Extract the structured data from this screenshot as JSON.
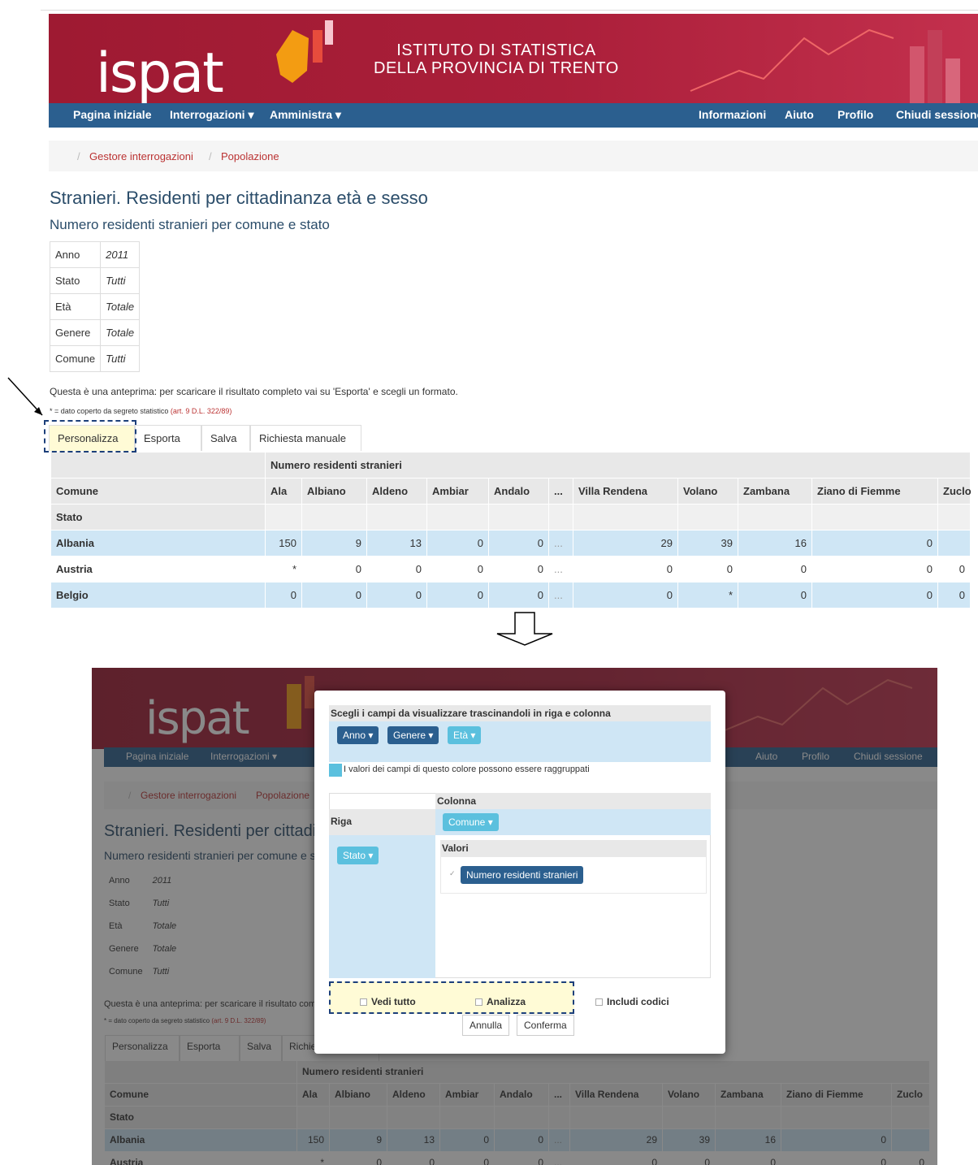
{
  "header": {
    "logo": "ispat",
    "institute_line1": "ISTITUTO DI STATISTICA",
    "institute_line2": "DELLA PROVINCIA DI TRENTO"
  },
  "nav": {
    "home": "Pagina iniziale",
    "queries": "Interrogazioni ▾",
    "admin": "Amministra ▾",
    "info": "Informazioni",
    "help": "Aiuto",
    "profile": "Profilo",
    "logout": "Chiudi sessione"
  },
  "breadcrumb": {
    "sep": "/",
    "item1": "Gestore interrogazioni",
    "item2": "Popolazione"
  },
  "page": {
    "title": "Stranieri. Residenti per cittadinanza età e sesso",
    "subtitle": "Numero residenti stranieri per comune e stato",
    "meta": [
      {
        "label": "Anno",
        "value": "2011"
      },
      {
        "label": "Stato",
        "value": "Tutti"
      },
      {
        "label": "Età",
        "value": "Totale"
      },
      {
        "label": "Genere",
        "value": "Totale"
      },
      {
        "label": "Comune",
        "value": "Tutti"
      }
    ],
    "preview_note": "Questa è una anteprima: per scaricare il risultato completo vai su 'Esporta' e scegli un formato.",
    "secret_note": "* = dato coperto da segreto statistico",
    "secret_ref": "(art. 9 D.L. 322/89)",
    "tabs": {
      "customize": "Personalizza",
      "export": "Esporta",
      "save": "Salva",
      "manual": "Richiesta manuale"
    }
  },
  "table": {
    "measure": "Numero residenti stranieri",
    "row_dim1": "Comune",
    "row_dim2": "Stato",
    "columns": [
      "Ala",
      "Albiano",
      "Aldeno",
      "Ambiar",
      "Andalo",
      "...",
      "Villa Rendena",
      "Volano",
      "Zambana",
      "Ziano di Fiemme",
      "Zuclo"
    ],
    "rows": [
      {
        "name": "Albania",
        "values": [
          "150",
          "9",
          "13",
          "0",
          "0",
          "...",
          "29",
          "39",
          "16",
          "0",
          ""
        ]
      },
      {
        "name": "Austria",
        "values": [
          "*",
          "0",
          "0",
          "0",
          "0",
          "...",
          "0",
          "0",
          "0",
          "0",
          "0"
        ]
      },
      {
        "name": "Belgio",
        "values": [
          "0",
          "0",
          "0",
          "0",
          "0",
          "...",
          "0",
          "*",
          "0",
          "0",
          "0"
        ]
      }
    ]
  },
  "arrow": {
    "symbol": "⇩"
  },
  "modal": {
    "instruction": "Scegli i campi da visualizzare trascinandoli in riga e colonna",
    "fields": {
      "anno": "Anno ▾",
      "genere": "Genere ▾",
      "eta": "Età ▾"
    },
    "legend": "I valori dei campi di questo colore possono essere raggruppati",
    "column_label": "Colonna",
    "row_label": "Riga",
    "column_field": "Comune ▾",
    "row_field": "Stato ▾",
    "values_label": "Valori",
    "value_item": "Numero residenti stranieri",
    "check_mark": "✓",
    "options": {
      "show_all": "Vedi tutto",
      "analyze": "Analizza",
      "include_codes": "Includi codici"
    },
    "cancel": "Annulla",
    "confirm": "Conferma"
  },
  "colors": {
    "banner": "#a51d36",
    "nav": "#2b5f8f",
    "row_highlight": "#cfe6f5",
    "pill_dark": "#2b5f8f",
    "pill_light": "#5bc0de",
    "highlight": "#fffbd6"
  }
}
